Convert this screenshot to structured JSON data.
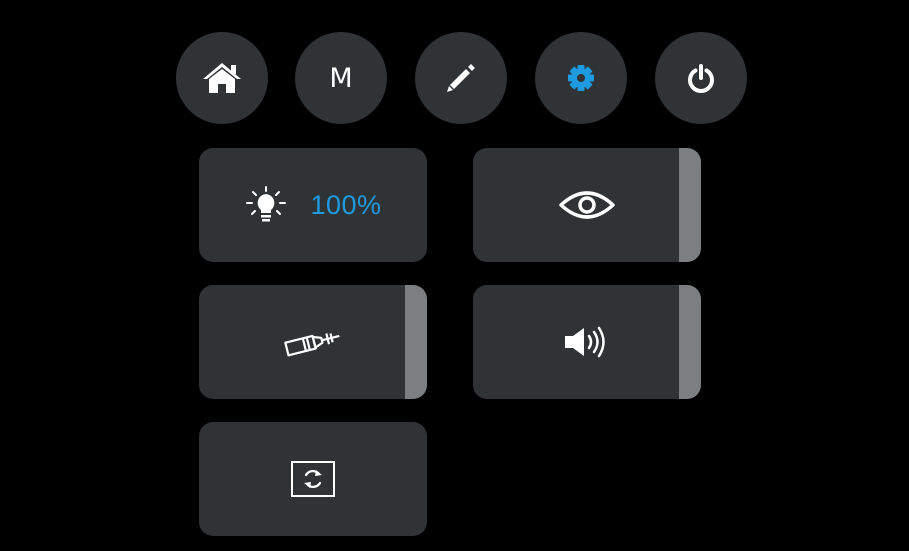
{
  "nav": {
    "home_icon": "home-icon",
    "mode_label": "M",
    "edit_icon": "pencil-icon",
    "settings_icon": "gear-icon",
    "power_icon": "power-icon",
    "active_item": "settings"
  },
  "tiles": {
    "brightness": {
      "icon": "light-bulb-icon",
      "value": "100%"
    },
    "visibility": {
      "icon": "eye-icon"
    },
    "syringe": {
      "icon": "syringe-icon"
    },
    "volume": {
      "icon": "speaker-volume-icon"
    },
    "rotate": {
      "icon": "rotate-screen-icon"
    }
  },
  "colors": {
    "background": "#000000",
    "surface": "#2f3336",
    "accent": "#1e9be0",
    "edge": "#7c7f81",
    "icon": "#ffffff"
  }
}
